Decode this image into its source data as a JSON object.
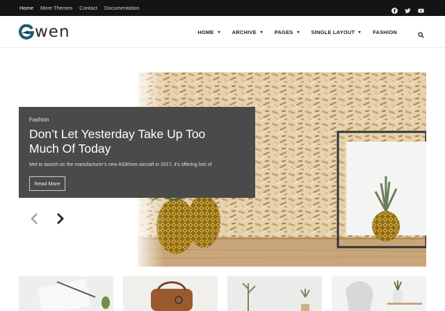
{
  "topbar": {
    "links": [
      "Home",
      "More Themes",
      "Contact",
      "Documentation"
    ],
    "active": "Home",
    "social": [
      "facebook-icon",
      "twitter-icon",
      "youtube-icon"
    ]
  },
  "header": {
    "logo_text": "wen",
    "nav": [
      {
        "label": "HOME",
        "has_dropdown": true
      },
      {
        "label": "ARCHIVE",
        "has_dropdown": true
      },
      {
        "label": "PAGES",
        "has_dropdown": true
      },
      {
        "label": "SINGLE LAYOUT",
        "has_dropdown": true
      },
      {
        "label": "FASHION",
        "has_dropdown": false
      }
    ],
    "search_icon": "search-icon"
  },
  "hero": {
    "category": "Fashion",
    "title": "Don’t Let Yesterday Take Up Too Much Of Today",
    "excerpt": "Met to launch on the manufacturer’s new A330neo aircraft in 2017, it’s offering lots of",
    "button": "Read More",
    "prev_icon": "chevron-left-icon",
    "next_icon": "chevron-right-icon"
  },
  "colors": {
    "topbar_bg": "#141414",
    "card_bg": "#4a4a4a",
    "logo_accent": "#1d5c73"
  },
  "thumbnails": [
    "thumbnail-1",
    "thumbnail-2",
    "thumbnail-3",
    "thumbnail-4"
  ]
}
